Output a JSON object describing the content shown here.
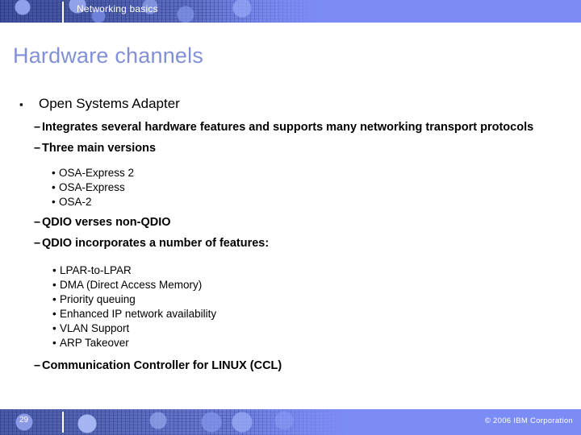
{
  "header": {
    "title": "Networking basics",
    "divider_color": "#ffffff",
    "bar_color": "#7b8cf5"
  },
  "slide": {
    "title": "Hardware channels",
    "title_color": "#8290d8"
  },
  "markers": {
    "square": "▪",
    "dash": "–",
    "dot": "•"
  },
  "content": {
    "items": [
      {
        "level": 1,
        "text": "Open Systems Adapter"
      },
      {
        "level": 2,
        "text": "Integrates several hardware features and supports many networking transport protocols"
      },
      {
        "level": 2,
        "text": "Three main versions"
      },
      {
        "level": 3,
        "text": "OSA-Express 2"
      },
      {
        "level": 3,
        "text": "OSA-Express"
      },
      {
        "level": 3,
        "text": "OSA-2"
      },
      {
        "level": 2,
        "text": "QDIO verses non-QDIO"
      },
      {
        "level": 2,
        "text": "QDIO incorporates a number of features:"
      },
      {
        "level": 3,
        "text": "LPAR-to-LPAR"
      },
      {
        "level": 3,
        "text": "DMA (Direct Access Memory)"
      },
      {
        "level": 3,
        "text": "Priority queuing"
      },
      {
        "level": 3,
        "text": "Enhanced IP network availability"
      },
      {
        "level": 3,
        "text": "VLAN Support"
      },
      {
        "level": 3,
        "text": "ARP Takeover"
      },
      {
        "level": 2,
        "text": "Communication Controller for LINUX (CCL)"
      }
    ]
  },
  "footer": {
    "page_number": "29",
    "copyright": "© 2006 IBM Corporation",
    "bar_color": "#7b8cf5"
  }
}
